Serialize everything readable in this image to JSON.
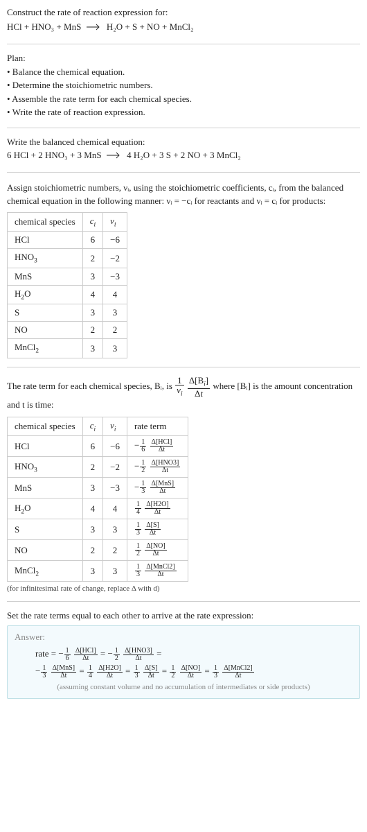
{
  "prompt": {
    "line1": "Construct the rate of reaction expression for:",
    "equation_lhs": "HCl + HNO₃ + MnS",
    "equation_rhs": "H₂O + S + NO + MnCl₂"
  },
  "plan": {
    "heading": "Plan:",
    "items": [
      "• Balance the chemical equation.",
      "• Determine the stoichiometric numbers.",
      "• Assemble the rate term for each chemical species.",
      "• Write the rate of reaction expression."
    ]
  },
  "balanced": {
    "heading": "Write the balanced chemical equation:",
    "lhs": "6 HCl + 2 HNO₃ + 3 MnS",
    "rhs": "4 H₂O + 3 S + 2 NO + 3 MnCl₂"
  },
  "stoich_text": "Assign stoichiometric numbers, νᵢ, using the stoichiometric coefficients, cᵢ, from the balanced chemical equation in the following manner: νᵢ = −cᵢ for reactants and νᵢ = cᵢ for products:",
  "table1": {
    "headers": [
      "chemical species",
      "cᵢ",
      "νᵢ"
    ],
    "rows": [
      [
        "HCl",
        "6",
        "−6"
      ],
      [
        "HNO₃",
        "2",
        "−2"
      ],
      [
        "MnS",
        "3",
        "−3"
      ],
      [
        "H₂O",
        "4",
        "4"
      ],
      [
        "S",
        "3",
        "3"
      ],
      [
        "NO",
        "2",
        "2"
      ],
      [
        "MnCl₂",
        "3",
        "3"
      ]
    ]
  },
  "rate_term_text1": "The rate term for each chemical species, Bᵢ, is ",
  "rate_term_text2": " where [Bᵢ] is the amount concentration and t is time:",
  "table2": {
    "headers": [
      "chemical species",
      "cᵢ",
      "νᵢ",
      "rate term"
    ],
    "rows": [
      {
        "sp": "HCl",
        "c": "6",
        "v": "−6",
        "sign": "−",
        "den": "6",
        "dnum": "Δ[HCl]",
        "dden": "Δt"
      },
      {
        "sp": "HNO₃",
        "c": "2",
        "v": "−2",
        "sign": "−",
        "den": "2",
        "dnum": "Δ[HNO3]",
        "dden": "Δt"
      },
      {
        "sp": "MnS",
        "c": "3",
        "v": "−3",
        "sign": "−",
        "den": "3",
        "dnum": "Δ[MnS]",
        "dden": "Δt"
      },
      {
        "sp": "H₂O",
        "c": "4",
        "v": "4",
        "sign": "",
        "den": "4",
        "dnum": "Δ[H2O]",
        "dden": "Δt"
      },
      {
        "sp": "S",
        "c": "3",
        "v": "3",
        "sign": "",
        "den": "3",
        "dnum": "Δ[S]",
        "dden": "Δt"
      },
      {
        "sp": "NO",
        "c": "2",
        "v": "2",
        "sign": "",
        "den": "2",
        "dnum": "Δ[NO]",
        "dden": "Δt"
      },
      {
        "sp": "MnCl₂",
        "c": "3",
        "v": "3",
        "sign": "",
        "den": "3",
        "dnum": "Δ[MnCl2]",
        "dden": "Δt"
      }
    ]
  },
  "note": "(for infinitesimal rate of change, replace Δ with d)",
  "final_heading": "Set the rate terms equal to each other to arrive at the rate expression:",
  "answer": {
    "label": "Answer:",
    "rate_prefix": "rate = ",
    "eq": " = ",
    "terms": [
      {
        "sign": "−",
        "den": "6",
        "dnum": "Δ[HCl]",
        "dden": "Δt"
      },
      {
        "sign": "−",
        "den": "2",
        "dnum": "Δ[HNO3]",
        "dden": "Δt"
      },
      {
        "sign": "−",
        "den": "3",
        "dnum": "Δ[MnS]",
        "dden": "Δt"
      },
      {
        "sign": "",
        "den": "4",
        "dnum": "Δ[H2O]",
        "dden": "Δt"
      },
      {
        "sign": "",
        "den": "3",
        "dnum": "Δ[S]",
        "dden": "Δt"
      },
      {
        "sign": "",
        "den": "2",
        "dnum": "Δ[NO]",
        "dden": "Δt"
      },
      {
        "sign": "",
        "den": "3",
        "dnum": "Δ[MnCl2]",
        "dden": "Δt"
      }
    ],
    "assume": "(assuming constant volume and no accumulation of intermediates or side products)"
  },
  "chart_data": {
    "type": "table",
    "title": "Stoichiometric and rate-term tables for HCl + HNO3 + MnS → H2O + S + NO + MnCl2",
    "balanced_equation": "6 HCl + 2 HNO3 + 3 MnS → 4 H2O + 3 S + 2 NO + 3 MnCl2",
    "stoichiometry": [
      {
        "species": "HCl",
        "c_i": 6,
        "nu_i": -6
      },
      {
        "species": "HNO3",
        "c_i": 2,
        "nu_i": -2
      },
      {
        "species": "MnS",
        "c_i": 3,
        "nu_i": -3
      },
      {
        "species": "H2O",
        "c_i": 4,
        "nu_i": 4
      },
      {
        "species": "S",
        "c_i": 3,
        "nu_i": 3
      },
      {
        "species": "NO",
        "c_i": 2,
        "nu_i": 2
      },
      {
        "species": "MnCl2",
        "c_i": 3,
        "nu_i": 3
      }
    ],
    "rate_terms": [
      {
        "species": "HCl",
        "coefficient": "-1/6",
        "expression": "Δ[HCl]/Δt"
      },
      {
        "species": "HNO3",
        "coefficient": "-1/2",
        "expression": "Δ[HNO3]/Δt"
      },
      {
        "species": "MnS",
        "coefficient": "-1/3",
        "expression": "Δ[MnS]/Δt"
      },
      {
        "species": "H2O",
        "coefficient": "1/4",
        "expression": "Δ[H2O]/Δt"
      },
      {
        "species": "S",
        "coefficient": "1/3",
        "expression": "Δ[S]/Δt"
      },
      {
        "species": "NO",
        "coefficient": "1/2",
        "expression": "Δ[NO]/Δt"
      },
      {
        "species": "MnCl2",
        "coefficient": "1/3",
        "expression": "Δ[MnCl2]/Δt"
      }
    ],
    "rate_expression": "rate = -1/6 Δ[HCl]/Δt = -1/2 Δ[HNO3]/Δt = -1/3 Δ[MnS]/Δt = 1/4 Δ[H2O]/Δt = 1/3 Δ[S]/Δt = 1/2 Δ[NO]/Δt = 1/3 Δ[MnCl2]/Δt"
  }
}
